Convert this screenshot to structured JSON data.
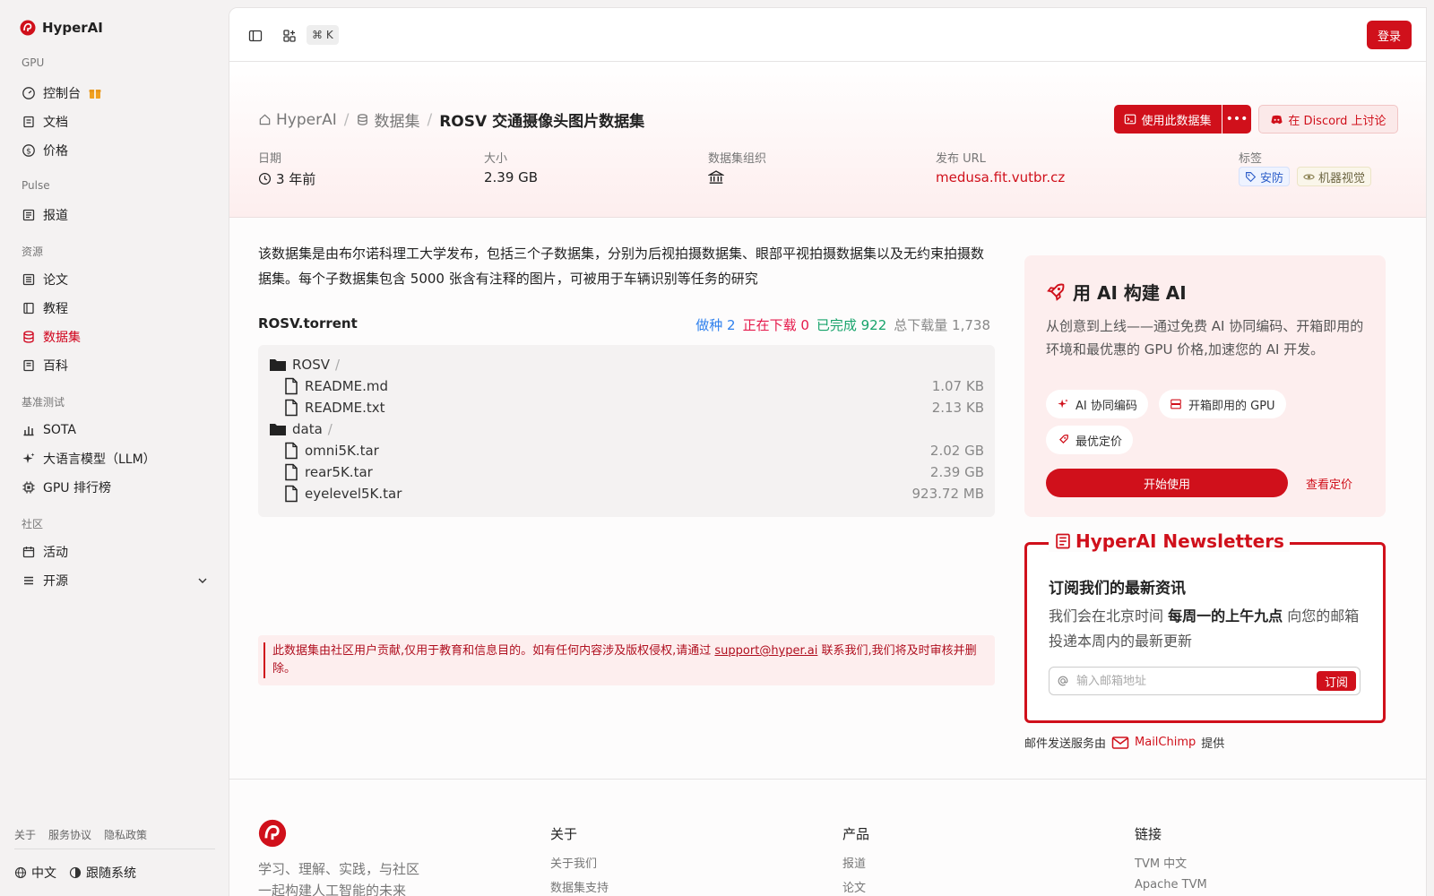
{
  "brand": {
    "name": "HyperAI"
  },
  "sidebar": {
    "sections": [
      {
        "title": "GPU",
        "items": [
          {
            "label": "控制台",
            "icon": "gauge-icon"
          },
          {
            "label": "文档",
            "icon": "book-icon"
          },
          {
            "label": "价格",
            "icon": "dollar-icon"
          }
        ]
      },
      {
        "title": "Pulse",
        "items": [
          {
            "label": "报道",
            "icon": "newspaper-icon"
          }
        ]
      },
      {
        "title": "资源",
        "items": [
          {
            "label": "论文",
            "icon": "paper-icon"
          },
          {
            "label": "教程",
            "icon": "tutorial-icon"
          },
          {
            "label": "数据集",
            "icon": "database-icon",
            "active": true
          },
          {
            "label": "百科",
            "icon": "wiki-icon"
          }
        ]
      },
      {
        "title": "基准测试",
        "items": [
          {
            "label": "SOTA",
            "icon": "bar-chart-icon"
          },
          {
            "label": "大语言模型（LLM）",
            "icon": "sparkle-icon"
          },
          {
            "label": "GPU 排行榜",
            "icon": "chip-icon"
          }
        ]
      },
      {
        "title": "社区",
        "items": [
          {
            "label": "活动",
            "icon": "calendar-icon"
          },
          {
            "label": "开源",
            "icon": "list-icon"
          }
        ]
      }
    ],
    "footer_links": [
      "关于",
      "服务协议",
      "隐私政策"
    ],
    "language": "中文",
    "theme": "跟随系统"
  },
  "topbar": {
    "shortcut": "⌘ K",
    "login": "登录"
  },
  "breadcrumb": {
    "home": "HyperAI",
    "section": "数据集",
    "current": "ROSV 交通摄像头图片数据集"
  },
  "actions": {
    "use_dataset": "使用此数据集",
    "more": "•••",
    "discord": "在 Discord 上讨论"
  },
  "meta": {
    "date_label": "日期",
    "date_value": "3 年前",
    "size_label": "大小",
    "size_value": "2.39 GB",
    "org_label": "数据集组织",
    "url_label": "发布 URL",
    "url_value": "medusa.fit.vutbr.cz",
    "tags_label": "标签",
    "tags": [
      "安防",
      "机器视觉"
    ]
  },
  "description": "该数据集是由布尔诺科理工大学发布，包括三个子数据集，分别为后视拍摄数据集、眼部平视拍摄数据集以及无约束拍摄数据集。每个子数据集包含 5000 张含有注释的图片，可被用于车辆识别等任务的研究",
  "torrent": {
    "name": "ROSV.torrent",
    "seeding": "做种 2",
    "downloading": "正在下载 0",
    "completed": "已完成 922",
    "total": "总下载量 1,738",
    "files": [
      {
        "type": "folder",
        "name": "ROSV",
        "size": ""
      },
      {
        "type": "file",
        "name": "README.md",
        "size": "1.07 KB"
      },
      {
        "type": "file",
        "name": "README.txt",
        "size": "2.13 KB"
      },
      {
        "type": "folder",
        "name": "data",
        "size": ""
      },
      {
        "type": "file",
        "name": "omni5K.tar",
        "size": "2.02 GB"
      },
      {
        "type": "file",
        "name": "rear5K.tar",
        "size": "2.39 GB"
      },
      {
        "type": "file",
        "name": "eyelevel5K.tar",
        "size": "923.72 MB"
      }
    ]
  },
  "notice": {
    "before": "此数据集由社区用户贡献,仅用于教育和信息目的。如有任何内容涉及版权侵权,请通过 ",
    "email": "support@hyper.ai",
    "after": " 联系我们,我们将及时审核并删除。"
  },
  "promo": {
    "title": "用 AI 构建 AI",
    "desc": "从创意到上线——通过免费 AI 协同编码、开箱即用的环境和最优惠的 GPU 价格,加速您的 AI 开发。",
    "chips": [
      "AI 协同编码",
      "开箱即用的 GPU",
      "最优定价"
    ],
    "start": "开始使用",
    "pricing": "查看定价"
  },
  "newsletter": {
    "legend": "HyperAI Newsletters",
    "heading": "订阅我们的最新资讯",
    "p1": "我们会在北京时间 ",
    "p_bold": "每周一的上午九点",
    "p2": " 向您的邮箱投递本周内的最新更新",
    "placeholder": "输入邮箱地址",
    "subscribe": "订阅",
    "credit_prefix": "邮件发送服务由",
    "credit_brand": "MailChimp",
    "credit_suffix": "提供"
  },
  "footer": {
    "tagline_1": "学习、理解、实践，与社区",
    "tagline_2": "一起构建人工智能的未来",
    "cols": [
      {
        "title": "关于",
        "links": [
          "关于我们",
          "数据集支持"
        ]
      },
      {
        "title": "产品",
        "links": [
          "报道",
          "论文"
        ]
      },
      {
        "title": "链接",
        "links": [
          "TVM 中文",
          "Apache TVM"
        ]
      }
    ]
  },
  "colors": {
    "accent": "#d0101b",
    "seeding": "#2f80ed",
    "downloading": "#e5194b",
    "completed": "#17a36b"
  }
}
